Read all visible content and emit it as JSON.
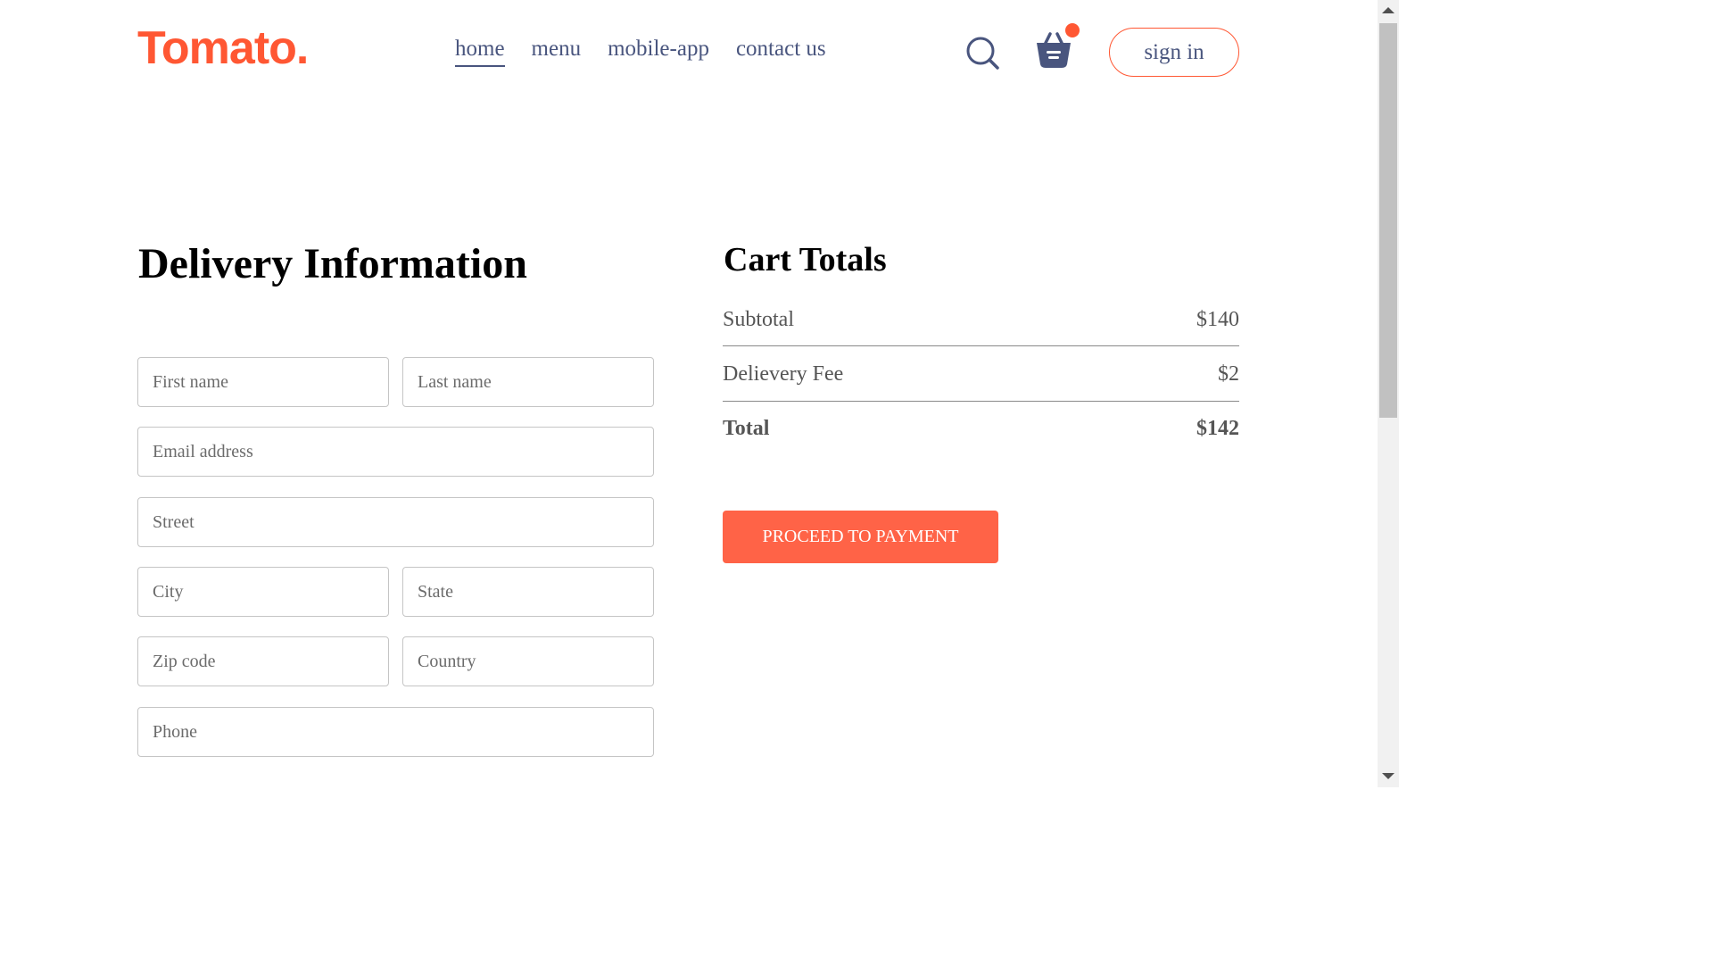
{
  "navbar": {
    "logo": "Tomato.",
    "menu": [
      {
        "label": "home",
        "active": true
      },
      {
        "label": "menu",
        "active": false
      },
      {
        "label": "mobile-app",
        "active": false
      },
      {
        "label": "contact us",
        "active": false
      }
    ],
    "search_icon": "search-icon",
    "cart_icon": "basket-icon",
    "cart_has_items": true,
    "signin_label": "sign in"
  },
  "delivery": {
    "title": "Delivery Information",
    "fields": {
      "first_name": "First name",
      "last_name": "Last name",
      "email": "Email address",
      "street": "Street",
      "city": "City",
      "state": "State",
      "zip": "Zip code",
      "country": "Country",
      "phone": "Phone"
    }
  },
  "cart_totals": {
    "title": "Cart Totals",
    "subtotal_label": "Subtotal",
    "subtotal_value": "$140",
    "fee_label": "Delievery Fee",
    "fee_value": "$2",
    "total_label": "Total",
    "total_value": "$142",
    "button_label": "PROCEED TO PAYMENT"
  },
  "colors": {
    "brand": "#ff5733",
    "button": "#ff6347",
    "nav_text": "#49557e"
  }
}
